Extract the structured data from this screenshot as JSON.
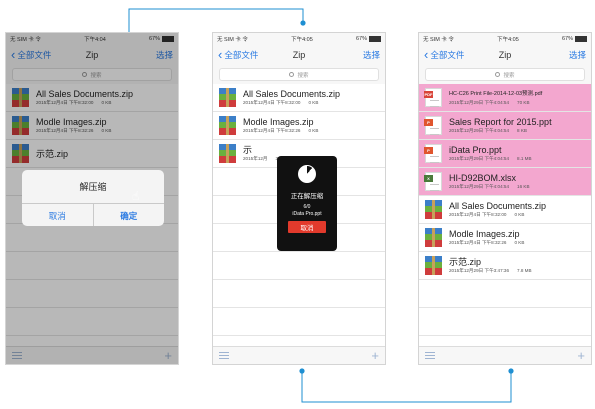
{
  "accent": "#2a7ae2",
  "connector_color": "#1e8fd2",
  "highlight_color": "#f3a7cf",
  "screens": [
    {
      "status": {
        "carrier": "无 SIM 卡 令",
        "time": "下午4:04",
        "battery": "67%"
      },
      "nav": {
        "back": "全部文件",
        "title": "Zip",
        "select": "选择"
      },
      "search": {
        "placeholder": "搜索"
      },
      "files": [
        {
          "name": "All Sales Documents.zip",
          "date": "2015年12月4日 下午8:32:00",
          "size": "0 KB",
          "icon": "zip-archive-icon"
        },
        {
          "name": "Modle Images.zip",
          "date": "2015年12月4日 下午8:32:26",
          "size": "0 KB",
          "icon": "zip-archive-icon"
        },
        {
          "name": "示范.zip",
          "date": "",
          "size": "",
          "icon": "zip-archive-icon"
        }
      ],
      "dialog": {
        "title": "解压缩",
        "cancel": "取消",
        "confirm": "确定"
      }
    },
    {
      "status": {
        "carrier": "无 SIM 卡 令",
        "time": "下午4:05",
        "battery": "67%"
      },
      "nav": {
        "back": "全部文件",
        "title": "Zip",
        "select": "选择"
      },
      "search": {
        "placeholder": "搜索"
      },
      "files": [
        {
          "name": "All Sales Documents.zip",
          "date": "2015年12月4日 下午8:32:00",
          "size": "0 KB",
          "icon": "zip-archive-icon"
        },
        {
          "name": "Modle Images.zip",
          "date": "2015年12月4日 下午8:32:26",
          "size": "0 KB",
          "icon": "zip-archive-icon"
        },
        {
          "name": "示",
          "date": "2015年12月",
          "size": "36  7.8 MB",
          "icon": "zip-archive-icon"
        }
      ],
      "progress": {
        "title": "正在解压缩",
        "count": "6/0",
        "file": "iData Pro.ppt",
        "cancel": "取消",
        "fraction": 0.11
      }
    },
    {
      "status": {
        "carrier": "无 SIM 卡 令",
        "time": "下午4:05",
        "battery": "67%"
      },
      "nav": {
        "back": "全部文件",
        "title": "Zip",
        "select": "选择"
      },
      "search": {
        "placeholder": "搜索"
      },
      "files": [
        {
          "name": "HC-C26 Print File-2014-12-03预测.pdf",
          "date": "2015年12月29日 下午4:04:54",
          "size": "70 KB",
          "icon": "pdf-file-icon",
          "highlight": true,
          "small": true
        },
        {
          "name": "Sales Report for 2015.ppt",
          "date": "2015年12月29日 下午4:04:54",
          "size": "8 KB",
          "icon": "ppt-file-icon",
          "highlight": true
        },
        {
          "name": "iData Pro.ppt",
          "date": "2015年12月29日 下午4:04:54",
          "size": "8.1 MB",
          "icon": "ppt-file-icon",
          "highlight": true
        },
        {
          "name": "HI-D92BOM.xlsx",
          "date": "2015年12月29日 下午4:04:54",
          "size": "16 KB",
          "icon": "excel-file-icon",
          "highlight": true
        },
        {
          "name": "All Sales Documents.zip",
          "date": "2015年12月4日 下午8:32:00",
          "size": "0 KB",
          "icon": "zip-archive-icon"
        },
        {
          "name": "Modle Images.zip",
          "date": "2015年12月4日 下午8:32:26",
          "size": "0 KB",
          "icon": "zip-archive-icon"
        },
        {
          "name": "示范.zip",
          "date": "2015年12月29日 下午3:47:36",
          "size": "7.8 MB",
          "icon": "zip-archive-icon"
        }
      ]
    }
  ]
}
